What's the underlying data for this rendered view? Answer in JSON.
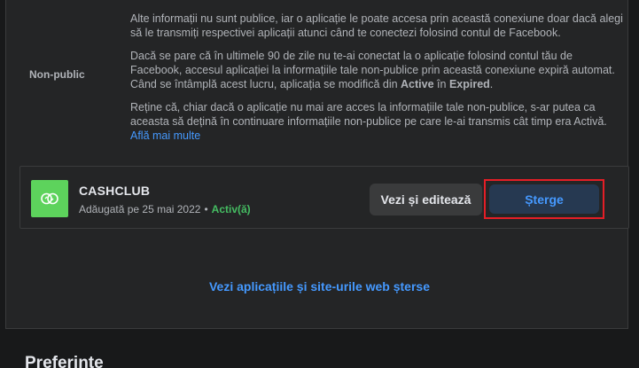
{
  "nonpublic": {
    "label": "Non-public",
    "para1": "Alte informații nu sunt publice, iar o aplicație le poate accesa prin această conexiune doar dacă alegi să le transmiți respectivei aplicații atunci când te conectezi folosind contul de Facebook.",
    "para2_start": "Dacă se pare că în ultimele 90 de zile nu te-ai conectat la o aplicație folosind contul tău de Facebook, accesul aplicației la informațiile tale non-publice prin această conexiune expiră automat. Când se întâmplă acest lucru, aplicația se modifică din ",
    "para2_active": "Active",
    "para2_mid": " în ",
    "para2_expired": "Expired",
    "para2_end": ".",
    "para3": "Reține că, chiar dacă o aplicație nu mai are acces la informațiile tale non-publice, s-ar putea ca aceasta să dețină în continuare informațiile non-publice pe care le-ai transmis cât timp era Activă.",
    "learn_more": "Află mai multe"
  },
  "app": {
    "name": "CASHCLUB",
    "added": "Adăugată pe 25 mai 2022",
    "separator": "•",
    "status": "Activ(ă)",
    "icon": "cashclub-logo-icon",
    "icon_color": "#5dd35c",
    "edit_label": "Vezi și editează",
    "delete_label": "Șterge"
  },
  "removed_link": "Vezi aplicațiile și site-urile web șterse",
  "preferences_title": "Preferințe",
  "colors": {
    "link": "#4599ff",
    "status": "#45bd62",
    "highlight": "#e41e26",
    "background": "#18191a",
    "card": "#242526"
  }
}
